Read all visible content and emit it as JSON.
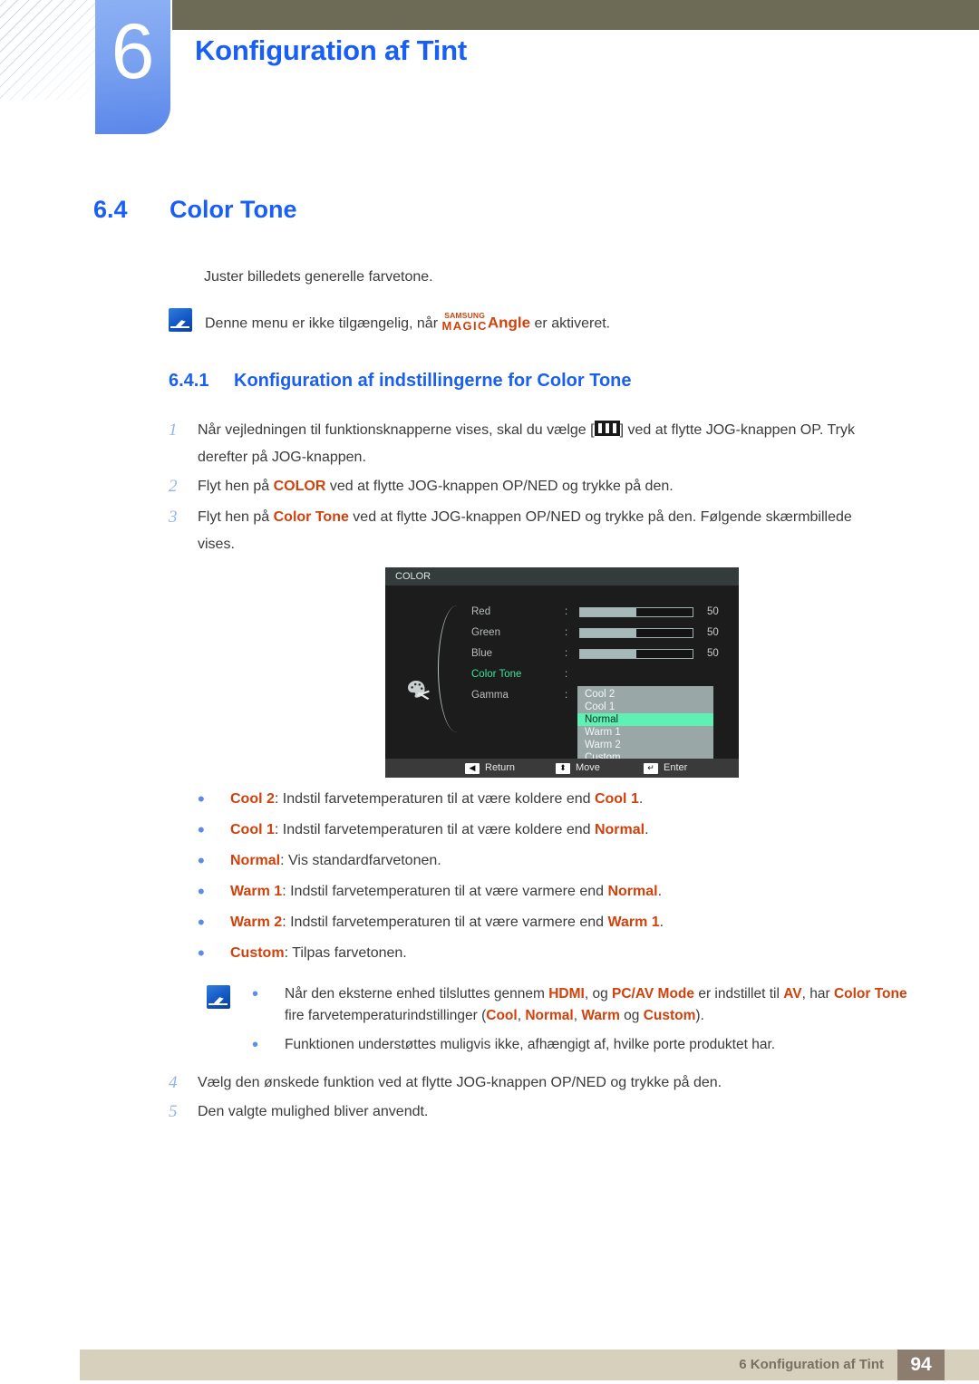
{
  "chapter": {
    "number": "6",
    "title": "Konfiguration af Tint"
  },
  "section": {
    "number": "6.4",
    "title": "Color Tone",
    "lead": "Juster billedets generelle farvetone."
  },
  "note_top": {
    "icon": "note-pen-icon",
    "text_before": "Denne menu er ikke tilgængelig, når",
    "logo_top": "SAMSUNG",
    "logo_bottom": "MAGIC",
    "logo_word": "Angle",
    "text_after": "er aktiveret."
  },
  "subsection": {
    "number": "6.4.1",
    "title": "Konfiguration af indstillingerne for Color Tone"
  },
  "steps": [
    {
      "n": "1",
      "parts": [
        {
          "t": "Når vejledningen til funktionsknapperne vises, skal du vælge [",
          "s": "plain"
        },
        {
          "t": "JOG-ICON",
          "s": "icon"
        },
        {
          "t": "] ved at flytte JOG-knappen OP. Tryk derefter på JOG-knappen.",
          "s": "plain"
        }
      ]
    },
    {
      "n": "2",
      "parts": [
        {
          "t": "Flyt hen på ",
          "s": "plain"
        },
        {
          "t": "COLOR",
          "s": "orange"
        },
        {
          "t": " ved at flytte JOG-knappen OP/NED og trykke på den.",
          "s": "plain"
        }
      ]
    },
    {
      "n": "3",
      "parts": [
        {
          "t": "Flyt hen på ",
          "s": "plain"
        },
        {
          "t": "Color Tone",
          "s": "orange"
        },
        {
          "t": " ved at flytte JOG-knappen OP/NED og trykke på den. Følgende skærmbillede vises.",
          "s": "plain"
        }
      ]
    },
    {
      "n": "4",
      "parts": [
        {
          "t": "Vælg den ønskede funktion ved at flytte JOG-knappen OP/NED og trykke på den.",
          "s": "plain"
        }
      ]
    },
    {
      "n": "5",
      "parts": [
        {
          "t": "Den valgte mulighed bliver anvendt.",
          "s": "plain"
        }
      ]
    }
  ],
  "osd": {
    "title": "COLOR",
    "menu_icon": "palette-icon",
    "rows": [
      {
        "label": "Red",
        "colon": ":",
        "value": "50",
        "fill": 50,
        "type": "slider"
      },
      {
        "label": "Green",
        "colon": ":",
        "value": "50",
        "fill": 50,
        "type": "slider"
      },
      {
        "label": "Blue",
        "colon": ":",
        "value": "50",
        "fill": 50,
        "type": "slider"
      },
      {
        "label": "Color Tone",
        "colon": ":",
        "value": "",
        "fill": 0,
        "type": "dropdown"
      },
      {
        "label": "Gamma",
        "colon": ":",
        "value": "",
        "fill": 0,
        "type": "none"
      }
    ],
    "dropdown_options": [
      "Cool 2",
      "Cool 1",
      "Normal",
      "Warm 1",
      "Warm 2",
      "Custom"
    ],
    "dropdown_selected": "Normal",
    "footer": [
      {
        "key": "◀",
        "label": "Return"
      },
      {
        "key": "⬍",
        "label": "Move"
      },
      {
        "key": "↵",
        "label": "Enter"
      }
    ],
    "colors": {
      "background": "#1c1c1c",
      "title_bar": "#333b3b",
      "highlight": "#5ff0b4",
      "active_label": "#39e39b",
      "dropdown_bg": "#9aa7a7"
    }
  },
  "bullets": [
    [
      {
        "t": "Cool 2",
        "s": "orange"
      },
      {
        "t": ": Indstil farvetemperaturen til at være koldere end ",
        "s": "plain"
      },
      {
        "t": "Cool 1",
        "s": "orange"
      },
      {
        "t": ".",
        "s": "plain"
      }
    ],
    [
      {
        "t": "Cool 1",
        "s": "orange"
      },
      {
        "t": ": Indstil farvetemperaturen til at være koldere end ",
        "s": "plain"
      },
      {
        "t": "Normal",
        "s": "orange"
      },
      {
        "t": ".",
        "s": "plain"
      }
    ],
    [
      {
        "t": "Normal",
        "s": "orange"
      },
      {
        "t": ": Vis standardfarvetonen.",
        "s": "plain"
      }
    ],
    [
      {
        "t": "Warm 1",
        "s": "orange"
      },
      {
        "t": ": Indstil farvetemperaturen til at være varmere end ",
        "s": "plain"
      },
      {
        "t": "Normal",
        "s": "orange"
      },
      {
        "t": ".",
        "s": "plain"
      }
    ],
    [
      {
        "t": "Warm 2",
        "s": "orange"
      },
      {
        "t": ": Indstil farvetemperaturen til at være varmere end ",
        "s": "plain"
      },
      {
        "t": "Warm 1",
        "s": "orange"
      },
      {
        "t": ".",
        "s": "plain"
      }
    ],
    [
      {
        "t": "Custom",
        "s": "orange"
      },
      {
        "t": ": Tilpas farvetonen.",
        "s": "plain"
      }
    ]
  ],
  "note_bottom": {
    "icon": "note-pen-icon",
    "items": [
      [
        {
          "t": "Når den eksterne enhed tilsluttes gennem ",
          "s": "plain"
        },
        {
          "t": "HDMI",
          "s": "orange"
        },
        {
          "t": ", og ",
          "s": "plain"
        },
        {
          "t": "PC/AV Mode",
          "s": "orange"
        },
        {
          "t": " er indstillet til ",
          "s": "plain"
        },
        {
          "t": "AV",
          "s": "orange"
        },
        {
          "t": ", har ",
          "s": "plain"
        },
        {
          "t": "Color Tone",
          "s": "orange"
        },
        {
          "t": " fire farvetemperaturindstillinger (",
          "s": "plain"
        },
        {
          "t": "Cool",
          "s": "orange"
        },
        {
          "t": ", ",
          "s": "plain"
        },
        {
          "t": "Normal",
          "s": "orange"
        },
        {
          "t": ", ",
          "s": "plain"
        },
        {
          "t": "Warm",
          "s": "orange"
        },
        {
          "t": " og ",
          "s": "plain"
        },
        {
          "t": "Custom",
          "s": "orange"
        },
        {
          "t": ").",
          "s": "plain"
        }
      ],
      [
        {
          "t": "Funktionen understøttes muligvis ikke, afhængigt af, hvilke porte produktet har.",
          "s": "plain"
        }
      ]
    ]
  },
  "footer": {
    "text": "6 Konfiguration af Tint",
    "page": "94"
  },
  "theme": {
    "blue": "#1a5ff5",
    "orange": "#d1410c",
    "olive": "#6d6a55",
    "tab_blue": "#5a86ea",
    "footer_bar": "#d6d0bd",
    "footer_page_bg": "#8d7d6f"
  }
}
